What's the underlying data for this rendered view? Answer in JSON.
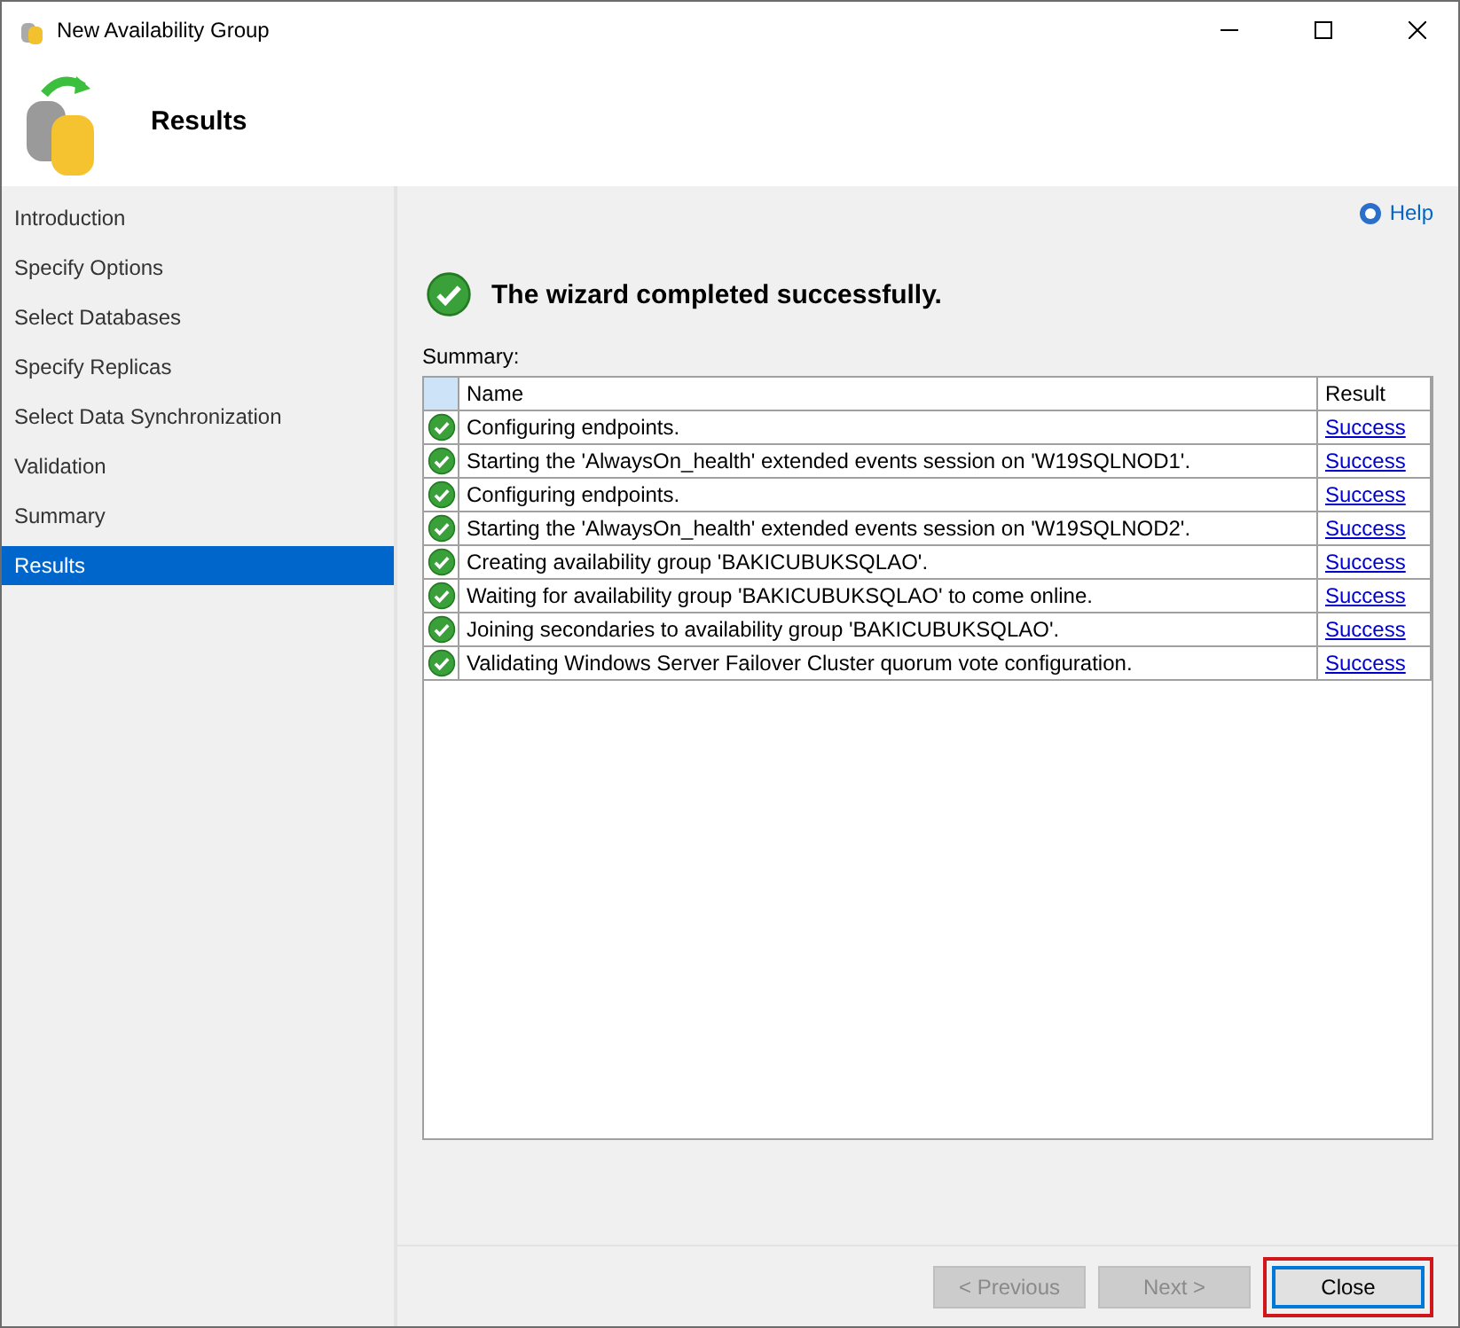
{
  "window": {
    "title": "New Availability Group"
  },
  "header": {
    "title": "Results"
  },
  "sidebar": {
    "items": [
      {
        "label": "Introduction",
        "selected": false
      },
      {
        "label": "Specify Options",
        "selected": false
      },
      {
        "label": "Select Databases",
        "selected": false
      },
      {
        "label": "Specify Replicas",
        "selected": false
      },
      {
        "label": "Select Data Synchronization",
        "selected": false
      },
      {
        "label": "Validation",
        "selected": false
      },
      {
        "label": "Summary",
        "selected": false
      },
      {
        "label": "Results",
        "selected": true
      }
    ]
  },
  "help": "Help",
  "status_message": "The wizard completed successfully.",
  "summary_label": "Summary:",
  "table": {
    "columns": [
      "Name",
      "Result"
    ],
    "rows": [
      {
        "name": "Configuring endpoints.",
        "result": "Success"
      },
      {
        "name": "Starting the 'AlwaysOn_health' extended events session on 'W19SQLNOD1'.",
        "result": "Success"
      },
      {
        "name": "Configuring endpoints.",
        "result": "Success"
      },
      {
        "name": "Starting the 'AlwaysOn_health' extended events session on 'W19SQLNOD2'.",
        "result": "Success"
      },
      {
        "name": "Creating availability group 'BAKICUBUKSQLAO'.",
        "result": "Success"
      },
      {
        "name": "Waiting for availability group 'BAKICUBUKSQLAO' to come online.",
        "result": "Success"
      },
      {
        "name": "Joining secondaries to availability group 'BAKICUBUKSQLAO'.",
        "result": "Success"
      },
      {
        "name": "Validating Windows Server Failover Cluster quorum vote configuration.",
        "result": "Success"
      }
    ]
  },
  "buttons": [
    {
      "label": "< Previous",
      "disabled": true,
      "highlighted": false
    },
    {
      "label": "Next >",
      "disabled": true,
      "highlighted": false
    },
    {
      "label": "Close",
      "disabled": false,
      "highlighted": true
    }
  ]
}
